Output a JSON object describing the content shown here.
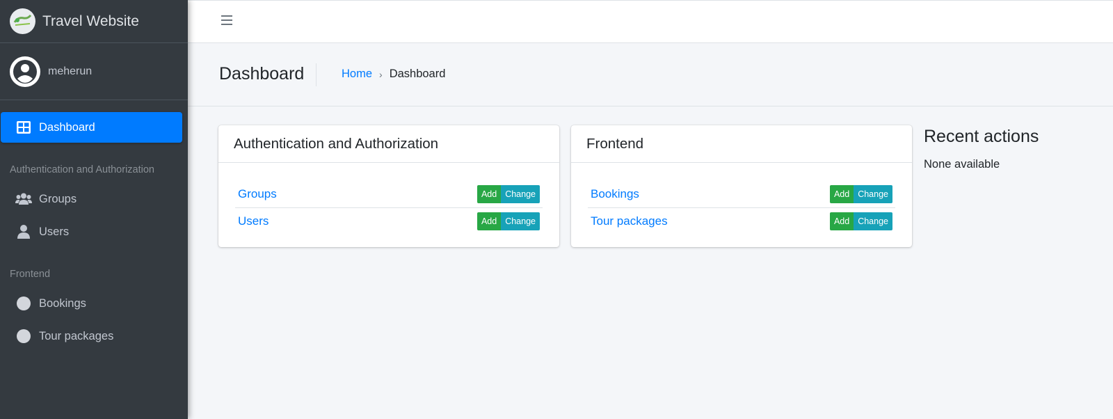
{
  "brand": {
    "name": "Travel Website",
    "logo_icon": "travel-logo"
  },
  "user": {
    "name": "meherun",
    "avatar_icon": "user-avatar-icon"
  },
  "sidebar": {
    "active_item": {
      "label": "Dashboard",
      "icon": "dashboard-icon"
    },
    "sections": [
      {
        "header": "Authentication and Authorization",
        "items": [
          {
            "label": "Groups",
            "icon": "users-group-icon"
          },
          {
            "label": "Users",
            "icon": "user-icon"
          }
        ]
      },
      {
        "header": "Frontend",
        "items": [
          {
            "label": "Bookings",
            "icon": "circle-icon"
          },
          {
            "label": "Tour packages",
            "icon": "circle-icon"
          }
        ]
      }
    ]
  },
  "topbar": {
    "menu_icon": "hamburger-menu-icon"
  },
  "header": {
    "title": "Dashboard",
    "breadcrumb": {
      "home": "Home",
      "separator": "›",
      "current": "Dashboard"
    }
  },
  "cards": [
    {
      "title": "Authentication and Authorization",
      "rows": [
        {
          "label": "Groups",
          "add": "Add",
          "change": "Change"
        },
        {
          "label": "Users",
          "add": "Add",
          "change": "Change"
        }
      ]
    },
    {
      "title": "Frontend",
      "rows": [
        {
          "label": "Bookings",
          "add": "Add",
          "change": "Change"
        },
        {
          "label": "Tour packages",
          "add": "Add",
          "change": "Change"
        }
      ]
    }
  ],
  "recent_actions": {
    "title": "Recent actions",
    "empty_text": "None available"
  },
  "colors": {
    "sidebar_bg": "#343a40",
    "primary": "#007bff",
    "add_button": "#28a745",
    "change_button": "#17a2b8",
    "content_bg": "#f4f6f9"
  }
}
